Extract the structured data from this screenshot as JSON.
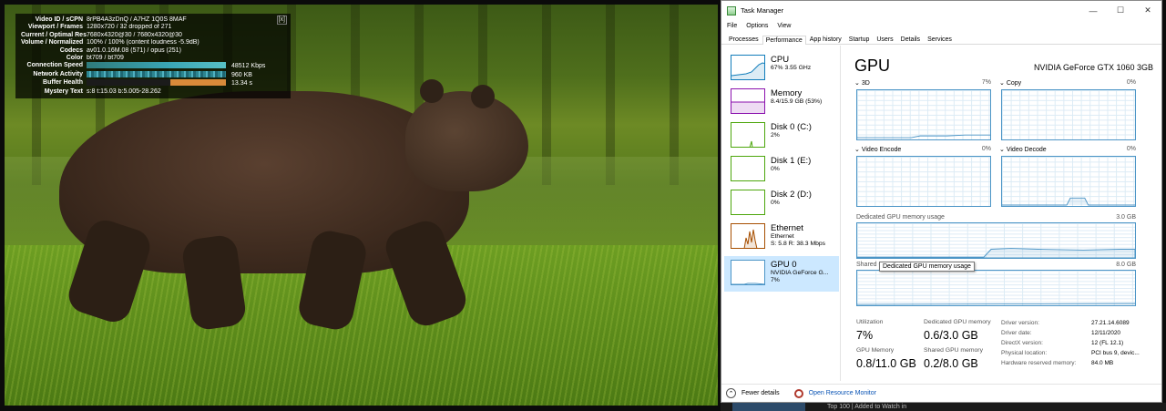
{
  "video": {
    "stats": {
      "close_label": "[x]",
      "rows": [
        {
          "k": "Video ID / sCPN",
          "v": "8rPB4A3zDnQ / A7HZ 1Q0S 8MAF"
        },
        {
          "k": "Viewport / Frames",
          "v": "1280x720 / 32 dropped of 271"
        },
        {
          "k": "Current / Optimal Res",
          "v": "7680x4320@30 / 7680x4320@30"
        },
        {
          "k": "Volume / Normalized",
          "v": "100% / 100% (content loudness -5.9dB)"
        },
        {
          "k": "Codecs",
          "v": "av01.0.16M.08 (571) / opus (251)"
        },
        {
          "k": "Color",
          "v": "bt709 / bt709"
        }
      ],
      "connection_speed": {
        "k": "Connection Speed",
        "v": "48512 Kbps"
      },
      "network_activity": {
        "k": "Network Activity",
        "v": "960 KB"
      },
      "buffer_health": {
        "k": "Buffer Health",
        "v": "13.34 s"
      },
      "mystery_text": {
        "k": "Mystery Text",
        "v": "s:8 t:15.03 b:5.005-28.262"
      }
    }
  },
  "taskmanager": {
    "title": "Task Manager",
    "window_buttons": {
      "minimize": "—",
      "maximize": "☐",
      "close": "✕"
    },
    "menu": [
      "File",
      "Options",
      "View"
    ],
    "tabs": [
      "Processes",
      "Performance",
      "App history",
      "Startup",
      "Users",
      "Details",
      "Services"
    ],
    "active_tab": "Performance",
    "sidebar": [
      {
        "name": "CPU",
        "line1": "67%  3.55 GHz",
        "line2": "",
        "color": "#117dbb"
      },
      {
        "name": "Memory",
        "line1": "8.4/15.9 GB (53%)",
        "line2": "",
        "color": "#8b12ae"
      },
      {
        "name": "Disk 0 (C:)",
        "line1": "2%",
        "line2": "",
        "color": "#4da60c"
      },
      {
        "name": "Disk 1 (E:)",
        "line1": "0%",
        "line2": "",
        "color": "#4da60c"
      },
      {
        "name": "Disk 2 (D:)",
        "line1": "0%",
        "line2": "",
        "color": "#4da60c"
      },
      {
        "name": "Ethernet",
        "line1": "Ethernet",
        "line2": "S: 5.8  R: 38.3 Mbps",
        "color": "#a74f01"
      },
      {
        "name": "GPU 0",
        "line1": "NVIDIA GeForce G...",
        "line2": "7%",
        "color": "#4c95c6"
      }
    ],
    "main": {
      "heading": "GPU",
      "gpu_name": "NVIDIA GeForce GTX 1060 3GB",
      "engines": [
        {
          "label": "3D",
          "pct": "7%"
        },
        {
          "label": "Copy",
          "pct": "0%"
        },
        {
          "label": "Video Encode",
          "pct": "0%"
        },
        {
          "label": "Video Decode",
          "pct": "0%"
        }
      ],
      "dedicated_label": "Dedicated GPU memory usage",
      "dedicated_max": "3.0 GB",
      "shared_label": "Shared G",
      "shared_max": "8.0 GB",
      "tooltip": "Dedicated GPU memory usage",
      "stats": {
        "utilization_label": "Utilization",
        "utilization": "7%",
        "dedicated_mem_label": "Dedicated GPU memory",
        "dedicated_mem": "0.6/3.0 GB",
        "gpu_mem_label": "GPU Memory",
        "gpu_mem": "0.8/11.0 GB",
        "shared_mem_label": "Shared GPU memory",
        "shared_mem": "0.2/8.0 GB"
      },
      "details": [
        {
          "k": "Driver version:",
          "v": "27.21.14.6089"
        },
        {
          "k": "Driver date:",
          "v": "12/11/2020"
        },
        {
          "k": "DirectX version:",
          "v": "12 (FL 12.1)"
        },
        {
          "k": "Physical location:",
          "v": "PCI bus 9, devic..."
        },
        {
          "k": "Hardware reserved memory:",
          "v": "84.0 MB"
        }
      ]
    },
    "footer": {
      "fewer_details": "Fewer details",
      "open_rm": "Open Resource Monitor"
    }
  },
  "behind_window_text": "Top 100 | Added to Watch in"
}
